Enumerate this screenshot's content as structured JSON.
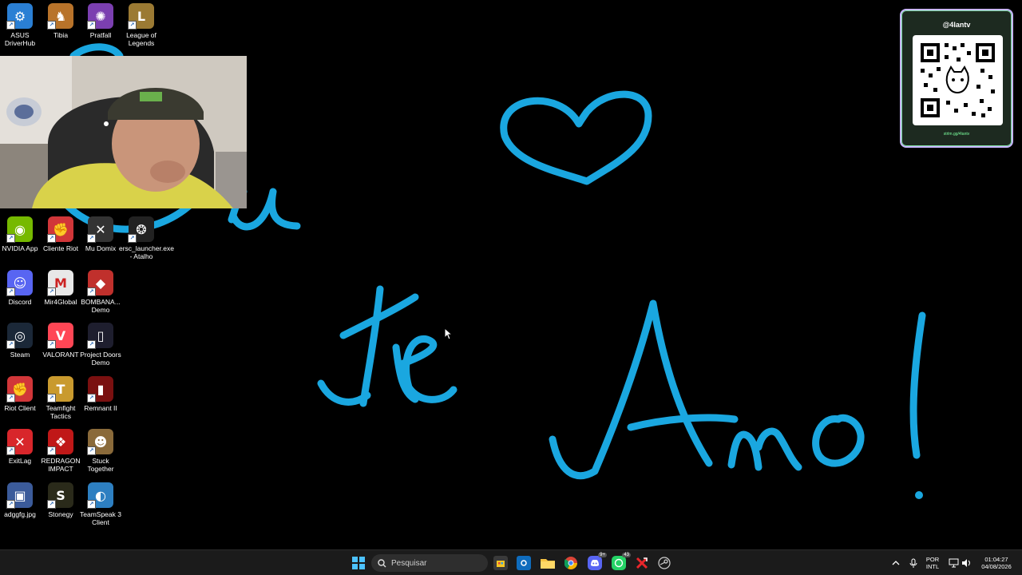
{
  "desktop": {
    "icons": [
      {
        "label": "ASUS DriverHub",
        "icon": "gear-icon",
        "color": "#2a7fd4"
      },
      {
        "label": "Tibia",
        "icon": "knight-icon",
        "color": "#b8732a"
      },
      {
        "label": "Pratfall",
        "icon": "creature-icon",
        "color": "#7b3fb0"
      },
      {
        "label": "League of Legends",
        "icon": "lol-icon",
        "color": "#9b7a33"
      },
      {
        "label": "NVIDIA App",
        "icon": "nvidia-icon",
        "color": "#76b900"
      },
      {
        "label": "Cliente Riot",
        "icon": "riot-icon",
        "color": "#d13639"
      },
      {
        "label": "Mu Domix",
        "icon": "mu-icon",
        "color": "#333333"
      },
      {
        "label": "ersc_launcher.exe - Atalho",
        "icon": "ersc-icon",
        "color": "#222222"
      },
      {
        "label": "Discord",
        "icon": "discord-icon",
        "color": "#5865f2"
      },
      {
        "label": "Mir4Global",
        "icon": "mir4-icon",
        "color": "#e8e8e8"
      },
      {
        "label": "BOMBANA... Demo",
        "icon": "car-icon",
        "color": "#c0302c"
      },
      {
        "label": "Steam",
        "icon": "steam-icon",
        "color": "#1b2838"
      },
      {
        "label": "VALORANT",
        "icon": "valorant-icon",
        "color": "#ff4655"
      },
      {
        "label": "Project Doors Demo",
        "icon": "door-icon",
        "color": "#1e1e2e"
      },
      {
        "label": "Riot Client",
        "icon": "riot-icon",
        "color": "#d13639"
      },
      {
        "label": "Teamfight Tactics",
        "icon": "tft-icon",
        "color": "#c99a2e"
      },
      {
        "label": "Remnant II",
        "icon": "remnant-icon",
        "color": "#7a1010"
      },
      {
        "label": "ExitLag",
        "icon": "exitlag-icon",
        "color": "#d8262b"
      },
      {
        "label": "REDRAGON IMPACT",
        "icon": "redragon-icon",
        "color": "#c01818"
      },
      {
        "label": "Stuck Together",
        "icon": "character-icon",
        "color": "#8a6a3a"
      },
      {
        "label": "adggfg.jpg",
        "icon": "image-file-icon",
        "color": "#3b5b9a"
      },
      {
        "label": "Stonegy",
        "icon": "stonegy-icon",
        "color": "#2a2a1a"
      },
      {
        "label": "TeamSpeak 3 Client",
        "icon": "teamspeak-icon",
        "color": "#2d7fc1"
      }
    ]
  },
  "qr_card": {
    "handle": "@4lantv",
    "url": "strlm.gg/4lantv"
  },
  "taskbar": {
    "search_placeholder": "Pesquisar",
    "apps": [
      "start-icon",
      "store-icon",
      "outlook-icon",
      "file-explorer-icon",
      "chrome-icon",
      "discord-icon",
      "whatsapp-icon",
      "exitlag-icon",
      "steam-icon"
    ],
    "discord_badge": "9+",
    "whatsapp_badge": "43",
    "language": "POR",
    "layout": "INTL",
    "time": "01:04:27",
    "date": "04/08/2026"
  }
}
